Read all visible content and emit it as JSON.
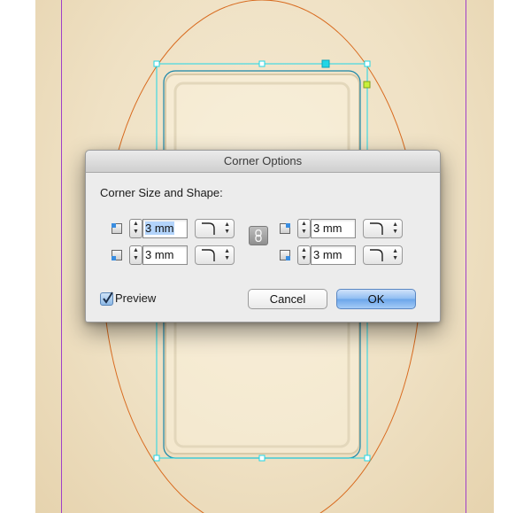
{
  "dialog": {
    "title": "Corner Options",
    "section_label": "Corner Size and Shape:",
    "corners": {
      "top_left": {
        "value": "3 mm",
        "selected": true,
        "shape": "rounded"
      },
      "top_right": {
        "value": "3 mm",
        "shape": "rounded"
      },
      "bottom_left": {
        "value": "3 mm",
        "shape": "rounded"
      },
      "bottom_right": {
        "value": "3 mm",
        "shape": "rounded"
      }
    },
    "preview": {
      "label": "Preview",
      "checked": true
    },
    "buttons": {
      "cancel": "Cancel",
      "ok": "OK"
    }
  },
  "colors": {
    "selection_cyan": "#20d6e6",
    "ellipse_orange": "#d86a1e",
    "guide_purple": "#a040c8",
    "ok_button_blue": "#7ab0ee"
  }
}
